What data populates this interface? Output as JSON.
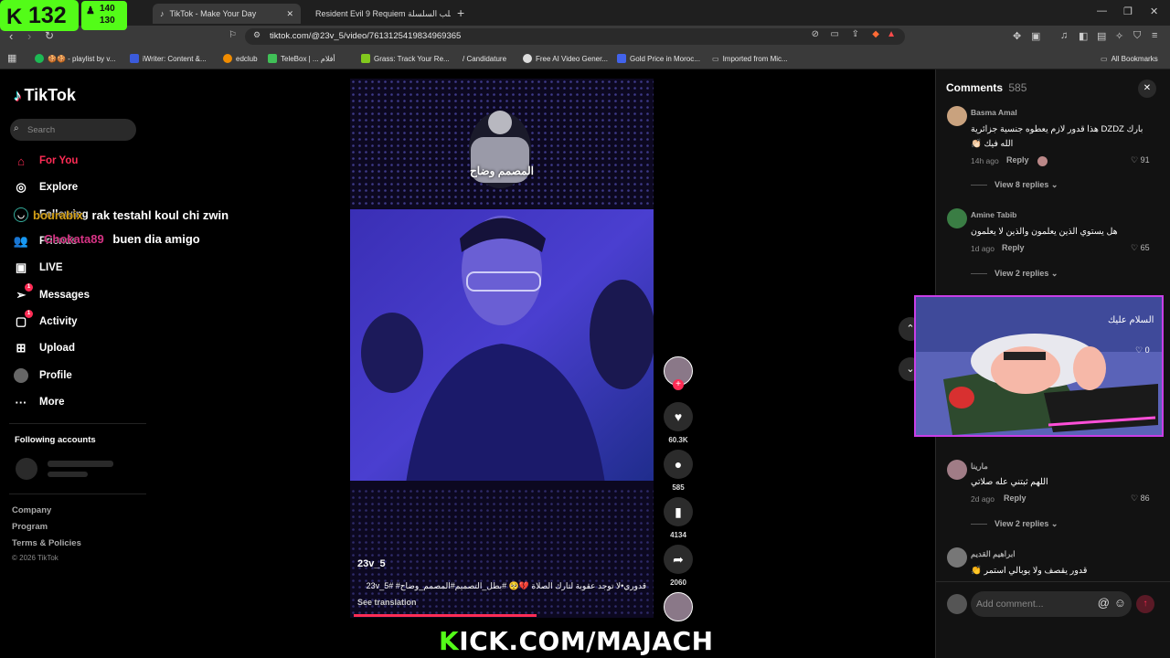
{
  "stream": {
    "viewer_count": "132",
    "follow_top": "140",
    "follow_bottom": "130",
    "banner_k": "K",
    "banner_rest": "ICK.COM/MAJACH",
    "chat": [
      {
        "user": "bourabix",
        "msg": "rak testahl koul chi zwin"
      },
      {
        "user": "Chokata89",
        "msg": "buen dia amigo"
      }
    ],
    "cam_greeting": "السلام عليك",
    "cam_likes": "0"
  },
  "browser": {
    "tabs": [
      {
        "label": "TikTok - Make Your Day"
      },
      {
        "label": "Resident Evil 9 Requiem قلب السلسلة"
      }
    ],
    "url": "tiktok.com/@23v_5/video/7613125419834969365",
    "bookmarks": [
      {
        "label": "🍪🍪 - playlist by v...",
        "color": "#1db954"
      },
      {
        "label": "iWriter: Content &...",
        "color": "#3b5bdb"
      },
      {
        "label": "edclub",
        "color": "#f08c00"
      },
      {
        "label": "TeleBox | ... أفلام",
        "color": "#40c057"
      },
      {
        "label": "Grass: Track Your Re...",
        "color": "#82c91e"
      },
      {
        "label": "/ Candidature",
        "color": "#3a3a3a"
      },
      {
        "label": "Free AI Video Gener...",
        "color": "#dddddd"
      },
      {
        "label": "Gold Price in Moroc...",
        "color": "#4263eb"
      },
      {
        "label": "Imported from Mic...",
        "color": "#3a3a3a"
      }
    ],
    "all_bookmarks": "All Bookmarks"
  },
  "tiktok": {
    "logo": "TikTok",
    "search_placeholder": "Search",
    "nav": [
      {
        "label": "For You",
        "icon": "home-icon",
        "active": true
      },
      {
        "label": "Explore",
        "icon": "compass-icon"
      },
      {
        "label": "Following",
        "icon": "following-icon"
      },
      {
        "label": "Friends",
        "icon": "friends-icon"
      },
      {
        "label": "LIVE",
        "icon": "live-icon"
      },
      {
        "label": "Messages",
        "icon": "messages-icon",
        "badge": "1"
      },
      {
        "label": "Activity",
        "icon": "activity-icon",
        "badge": "1"
      },
      {
        "label": "Upload",
        "icon": "upload-icon"
      },
      {
        "label": "Profile",
        "icon": "avatar"
      },
      {
        "label": "More",
        "icon": "more-icon"
      }
    ],
    "following_accounts": "Following accounts",
    "footer": [
      "Company",
      "Program",
      "Terms & Policies"
    ],
    "copyright": "© 2026 TikTok",
    "accent": "#fe2c55"
  },
  "video": {
    "overlay_title": "المصمم وضاح",
    "author": "23v_5",
    "caption": "قدوري•لا توجد عقوبة لتارك الصلاة 💔🥺 #بطل_التصميم#المصمم_وضاح# #23v_5",
    "see_translation": "See translation",
    "likes": "60.3K",
    "comments": "585",
    "saves": "4134",
    "shares": "2060"
  },
  "comments_panel": {
    "title": "Comments",
    "count": "585",
    "placeholder": "Add comment...",
    "items": [
      {
        "name": "Basma Amal",
        "text_line1": "بارك DZDZ هذا قدور لازم يعطوه جنسية جزائرية",
        "text_line2": "الله فيك 👏🏻",
        "time": "14h ago",
        "reply": "Reply",
        "likes": "91",
        "view_replies": "View 8 replies",
        "avatar": "#c9a27e"
      },
      {
        "name": "Amine Tabib",
        "text_line1": "هل يستوي الذين يعلمون والذين لا يعلمون",
        "time": "1d ago",
        "reply": "Reply",
        "likes": "65",
        "view_replies": "View 2 replies",
        "avatar": "#3a7d44"
      },
      {
        "name": "مارينا",
        "text_line1": "اللهم ثبتني عله صلاتي",
        "time": "2d ago",
        "reply": "Reply",
        "likes": "86",
        "view_replies": "View 2 replies",
        "avatar": "#a07c86"
      },
      {
        "name": "ابراهيم القديم",
        "text_line1": "قدور يقصف ولا يوبالي استمر 👏",
        "avatar": "#777777"
      }
    ]
  }
}
